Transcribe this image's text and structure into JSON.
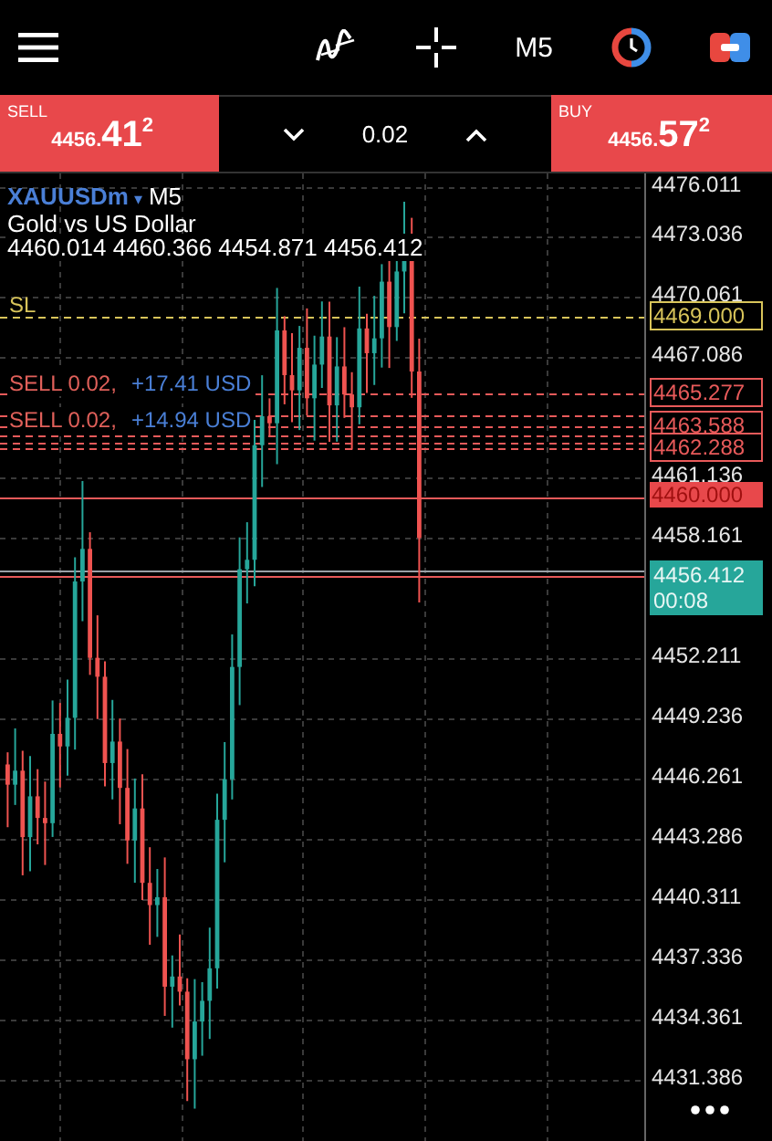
{
  "toolbar": {
    "timeframe": "M5"
  },
  "order_bar": {
    "sell": {
      "label": "SELL",
      "price_main": "4456.",
      "price_big": "41",
      "price_sup": "2"
    },
    "volume": "0.02",
    "buy": {
      "label": "BUY",
      "price_main": "4456.",
      "price_big": "57",
      "price_sup": "2"
    }
  },
  "chart": {
    "symbol": "XAUUSDm",
    "symbol_caret": "▾",
    "timeframe": "M5",
    "description": "Gold vs US Dollar",
    "ohlc": "4460.014 4460.366 4454.871 4456.412",
    "sl_label": "SL",
    "trades": [
      {
        "side": "SELL 0.02,",
        "profit": "+17.41 USD"
      },
      {
        "side": "SELL 0.02,",
        "profit": "+14.94 USD"
      }
    ],
    "price_axis": [
      "4476.011",
      "4473.036",
      "4470.061",
      "4467.086",
      "4461.136",
      "4458.161",
      "4452.211",
      "4449.236",
      "4446.261",
      "4443.286",
      "4440.311",
      "4437.336",
      "4434.361",
      "4431.386"
    ],
    "price_markers": [
      {
        "kind": "sl",
        "text": "4469.000"
      },
      {
        "kind": "order",
        "text": "4465.277"
      },
      {
        "kind": "order",
        "text": "4463.588"
      },
      {
        "kind": "order",
        "text": "4462.288"
      },
      {
        "kind": "close",
        "text": "4460.000"
      },
      {
        "kind": "current",
        "text": "4456.412",
        "timer": "00:08"
      }
    ]
  }
}
